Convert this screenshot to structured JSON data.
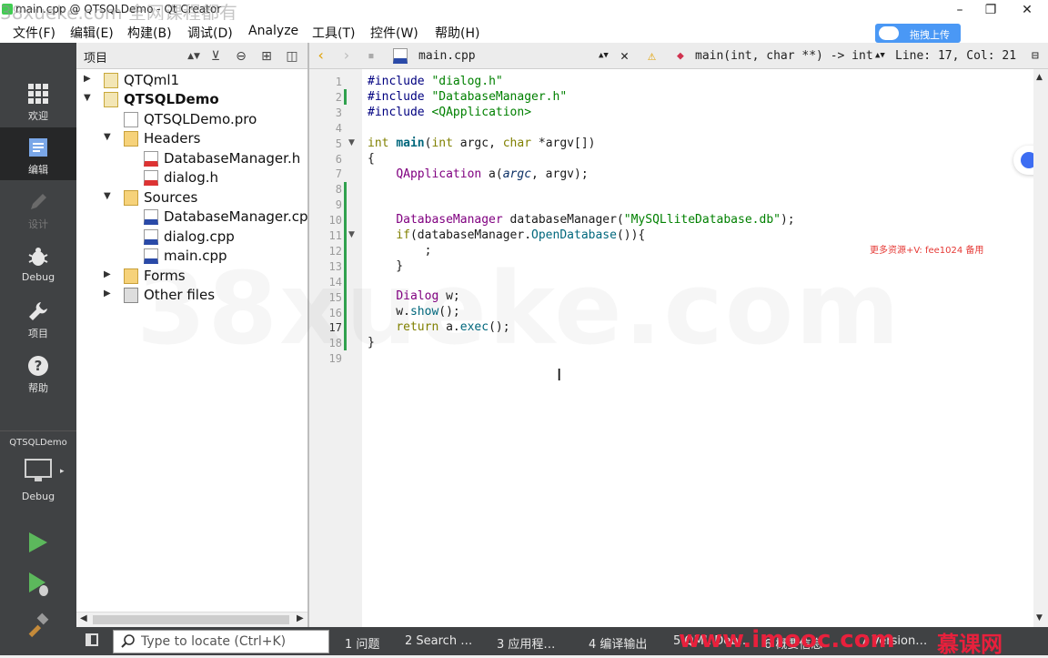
{
  "window": {
    "title": "main.cpp @ QTSQLDemo - Qt Creator",
    "watermark": "38xueke.com 全网课程都有"
  },
  "menu": [
    "文件(F)",
    "编辑(E)",
    "构建(B)",
    "调试(D)",
    "Analyze",
    "工具(T)",
    "控件(W)",
    "帮助(H)"
  ],
  "upload_button": "拖拽上传",
  "modes": [
    {
      "label": "欢迎",
      "icon": "grid-icon"
    },
    {
      "label": "编辑",
      "icon": "edit-doc-icon",
      "active": true
    },
    {
      "label": "设计",
      "icon": "pencil-icon",
      "disabled": true
    },
    {
      "label": "Debug",
      "icon": "bug-icon"
    },
    {
      "label": "项目",
      "icon": "wrench-icon"
    },
    {
      "label": "帮助",
      "icon": "help-icon"
    }
  ],
  "kit": {
    "project": "QTSQLDemo",
    "config": "Debug"
  },
  "projects_panel": {
    "title": "项目",
    "tree": [
      {
        "label": "QTQml1",
        "kind": "project"
      },
      {
        "label": "QTSQLDemo",
        "kind": "project-active"
      },
      {
        "label": "QTSQLDemo.pro",
        "kind": "pro"
      },
      {
        "label": "Headers",
        "kind": "folder"
      },
      {
        "label": "DatabaseManager.h",
        "kind": "header"
      },
      {
        "label": "dialog.h",
        "kind": "header"
      },
      {
        "label": "Sources",
        "kind": "folder"
      },
      {
        "label": "DatabaseManager.cpp",
        "kind": "cpp"
      },
      {
        "label": "dialog.cpp",
        "kind": "cpp"
      },
      {
        "label": "main.cpp",
        "kind": "cpp"
      },
      {
        "label": "Forms",
        "kind": "folder"
      },
      {
        "label": "Other files",
        "kind": "other"
      }
    ]
  },
  "editor": {
    "file": "main.cpp",
    "symbol": "main(int, char **) -> int",
    "position": "Line: 17, Col: 21",
    "line_numbers": [
      "1",
      "2",
      "3",
      "4",
      "5",
      "6",
      "7",
      "8",
      "9",
      "10",
      "11",
      "12",
      "13",
      "14",
      "15",
      "16",
      "17",
      "18",
      "19"
    ],
    "current_line": 17
  },
  "note": "更多资源+V: fee1024 备用",
  "bg_watermark": "38xueke.com",
  "locator_placeholder": "Type to locate (Ctrl+K)",
  "output_tabs": [
    "1 问题",
    "2 Search …",
    "3 应用程…",
    "4 编译输出",
    "5 QML Deb…",
    "6 概要信息",
    "7 Version…"
  ],
  "brand": {
    "left": "www.imooc.com",
    "right": "慕课网",
    "color": "#e8203c"
  },
  "colors": {
    "modebar": "#404244",
    "active_mode": "#262728",
    "keyword": "#808000",
    "string": "#008000",
    "type": "#800080"
  }
}
